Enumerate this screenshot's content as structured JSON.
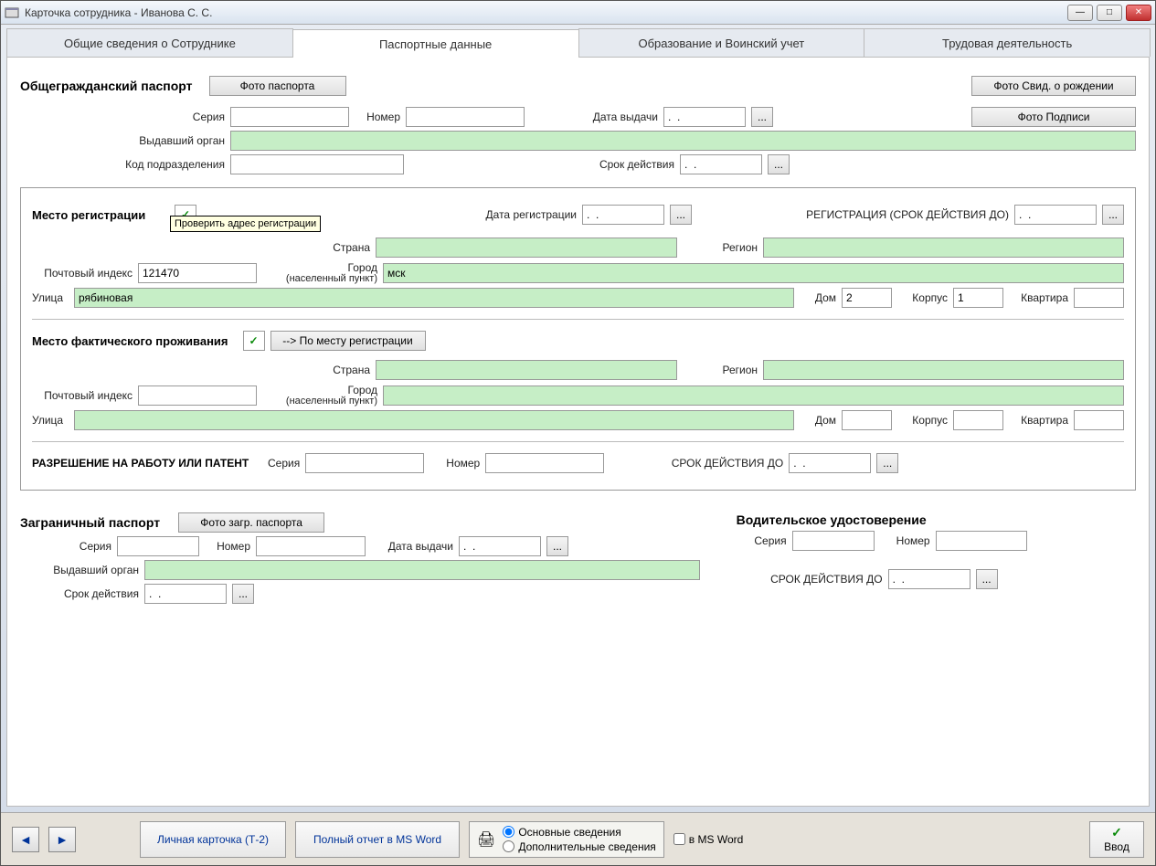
{
  "window": {
    "title": "Карточка сотрудника  -  Иванова С. С."
  },
  "tabs": {
    "general": "Общие сведения о Сотруднике",
    "passport": "Паспортные данные",
    "education": "Образование и Воинский учет",
    "work": "Трудовая деятельность"
  },
  "passport": {
    "heading": "Общегражданский паспорт",
    "photo_btn": "Фото паспорта",
    "birth_cert_btn": "Фото Свид. о рождении",
    "signature_btn": "Фото Подписи",
    "series_label": "Серия",
    "number_label": "Номер",
    "issue_date_label": "Дата выдачи",
    "issue_date_value": ".  .",
    "issuer_label": "Выдавший орган",
    "dept_code_label": "Код подразделения",
    "validity_label": "Срок действия",
    "validity_value": ".  ."
  },
  "registration": {
    "heading": "Место регистрации",
    "tooltip": "Проверить адрес регистрации",
    "reg_date_label": "Дата регистрации",
    "reg_date_value": ".  .",
    "reg_validity_label": "РЕГИСТРАЦИЯ (СРОК ДЕЙСТВИЯ ДО)",
    "reg_validity_value": ".  .",
    "country_label": "Страна",
    "region_label": "Регион",
    "postal_label": "Почтовый индекс",
    "postal_value": "121470",
    "city_label": "Город",
    "city_sublabel": "(населенный пункт)",
    "city_value": "мск",
    "street_label": "Улица",
    "street_value": "рябиновая",
    "house_label": "Дом",
    "house_value": "2",
    "building_label": "Корпус",
    "building_value": "1",
    "flat_label": "Квартира"
  },
  "residence": {
    "heading": "Место фактического проживания",
    "copy_btn": "--> По месту регистрации",
    "country_label": "Страна",
    "region_label": "Регион",
    "postal_label": "Почтовый индекс",
    "city_label": "Город",
    "city_sublabel": "(населенный пункт)",
    "street_label": "Улица",
    "house_label": "Дом",
    "building_label": "Корпус",
    "flat_label": "Квартира"
  },
  "permit": {
    "heading": "РАЗРЕШЕНИЕ НА РАБОТУ ИЛИ ПАТЕНТ",
    "series_label": "Серия",
    "number_label": "Номер",
    "validity_label": "СРОК ДЕЙСТВИЯ ДО",
    "validity_value": ".  ."
  },
  "foreign": {
    "heading": "Заграничный паспорт",
    "photo_btn": "Фото загр. паспорта",
    "series_label": "Серия",
    "number_label": "Номер",
    "issue_date_label": "Дата выдачи",
    "issue_date_value": ".  .",
    "issuer_label": "Выдавший орган",
    "validity_label": "Срок действия",
    "validity_value": ".  ."
  },
  "driver": {
    "heading": "Водительское удостоверение",
    "series_label": "Серия",
    "number_label": "Номер",
    "validity_label": "СРОК ДЕЙСТВИЯ ДО",
    "validity_value": ".  ."
  },
  "footer": {
    "card_btn": "Личная карточка (Т-2)",
    "report_btn": "Полный отчет в MS Word",
    "radio_main": "Основные сведения",
    "radio_extra": "Дополнительные сведения",
    "msword_label": "в MS Word",
    "enter_btn": "Ввод"
  }
}
